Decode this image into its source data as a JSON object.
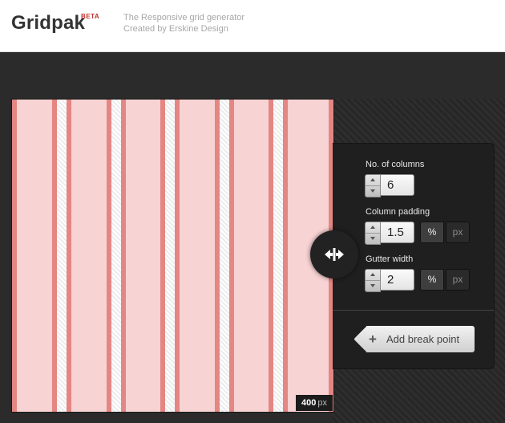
{
  "header": {
    "title": "Gridpak",
    "badge": "BETA",
    "tagline_line1": "The Responsive grid generator",
    "tagline_line2": "Created by Erskine Design"
  },
  "preview": {
    "width_value": "400",
    "width_unit": "px",
    "column_count": 6
  },
  "handle": {
    "icon": "resize-horizontal-icon"
  },
  "controls": {
    "columns_label": "No. of columns",
    "columns_value": "6",
    "padding_label": "Column padding",
    "padding_value": "1.5",
    "padding_unit_percent": "%",
    "padding_unit_px": "px",
    "gutter_label": "Gutter width",
    "gutter_value": "2",
    "gutter_unit_percent": "%",
    "gutter_unit_px": "px"
  },
  "add_breakpoint": {
    "label": "Add break point",
    "icon": "plus-icon"
  },
  "colors": {
    "column_fill": "#f8d3d3",
    "column_padding": "#e48683",
    "active_unit": "%"
  }
}
